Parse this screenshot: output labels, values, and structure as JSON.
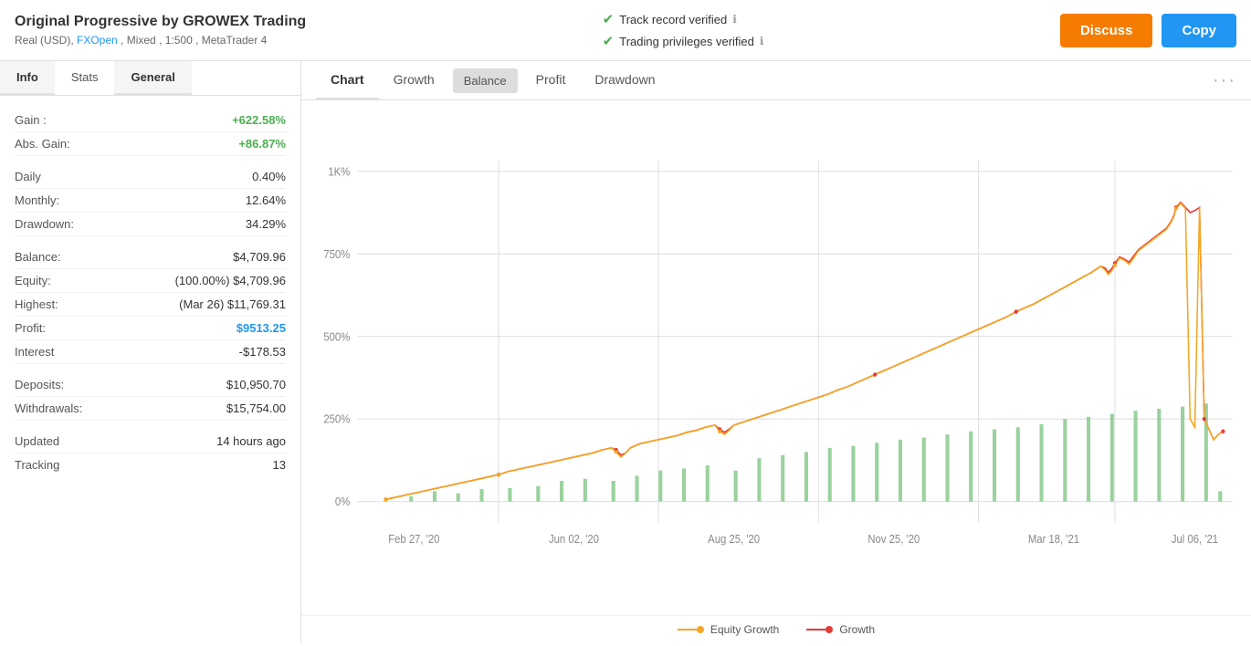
{
  "header": {
    "title": "Original Progressive by GROWEX Trading",
    "subtitle": "Real (USD), FXOpen , Mixed , 1:500 , MetaTrader 4",
    "fxopen_link": "FXOpen",
    "verified1": "Track record verified",
    "verified2": "Trading privileges verified",
    "btn_discuss": "Discuss",
    "btn_copy": "Copy"
  },
  "tabs_left": [
    {
      "label": "Info",
      "active": true
    },
    {
      "label": "Stats",
      "active": false
    },
    {
      "label": "General",
      "active": false
    }
  ],
  "info": {
    "gain_label": "Gain :",
    "gain_value": "+622.58%",
    "abs_gain_label": "Abs. Gain:",
    "abs_gain_value": "+86.87%",
    "daily_label": "Daily",
    "daily_value": "0.40%",
    "monthly_label": "Monthly:",
    "monthly_value": "12.64%",
    "drawdown_label": "Drawdown:",
    "drawdown_value": "34.29%",
    "balance_label": "Balance:",
    "balance_value": "$4,709.96",
    "equity_label": "Equity:",
    "equity_value": "(100.00%) $4,709.96",
    "highest_label": "Highest:",
    "highest_value": "(Mar 26) $11,769.31",
    "profit_label": "Profit:",
    "profit_value": "$9513.25",
    "interest_label": "Interest",
    "interest_value": "-$178.53",
    "deposits_label": "Deposits:",
    "deposits_value": "$10,950.70",
    "withdrawals_label": "Withdrawals:",
    "withdrawals_value": "$15,754.00",
    "updated_label": "Updated",
    "updated_value": "14 hours ago",
    "tracking_label": "Tracking",
    "tracking_value": "13"
  },
  "tabs_right": [
    {
      "label": "Chart",
      "active": true,
      "type": "plain"
    },
    {
      "label": "Growth",
      "active": false,
      "type": "plain"
    },
    {
      "label": "Balance",
      "active": false,
      "type": "grey"
    },
    {
      "label": "Profit",
      "active": false,
      "type": "plain"
    },
    {
      "label": "Drawdown",
      "active": false,
      "type": "plain"
    }
  ],
  "chart": {
    "y_labels": [
      "0%",
      "250%",
      "500%",
      "750%",
      "1K%"
    ],
    "x_labels": [
      "Feb 27, '20",
      "Jun 02, '20",
      "Aug 25, '20",
      "Nov 25, '20",
      "Mar 18, '21",
      "Jul 06, '21"
    ],
    "legend": [
      {
        "label": "Equity Growth",
        "color": "#f5a623"
      },
      {
        "label": "Growth",
        "color": "#e53935"
      }
    ]
  }
}
